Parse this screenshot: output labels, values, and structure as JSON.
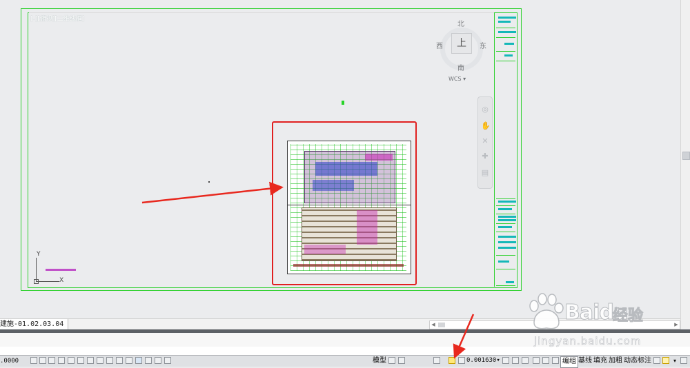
{
  "layout_title": "[-][俯视][二维线框]",
  "compass": {
    "north": "北",
    "south": "南",
    "east": "东",
    "west": "西",
    "top_face": "上",
    "wcs_label": "WCS"
  },
  "ucs": {
    "y_label": "Y",
    "x_label": "X"
  },
  "layout_tab": "建施-01.02.03.04",
  "status": {
    "coordinates": ".0000",
    "model_label": "模型",
    "annotation_scale": "0.001630",
    "toggles": [
      "编组",
      "基线",
      "填充",
      "加粗",
      "动态标注"
    ]
  },
  "watermark": {
    "brand": "Baidu",
    "cn": "经验",
    "url": "jingyan.baidu.com"
  },
  "colors": {
    "frame_green": "#2fd12f",
    "highlight_red": "#e02020",
    "arrow_red": "#e8281e",
    "canvas_bg": "#ebecee"
  }
}
